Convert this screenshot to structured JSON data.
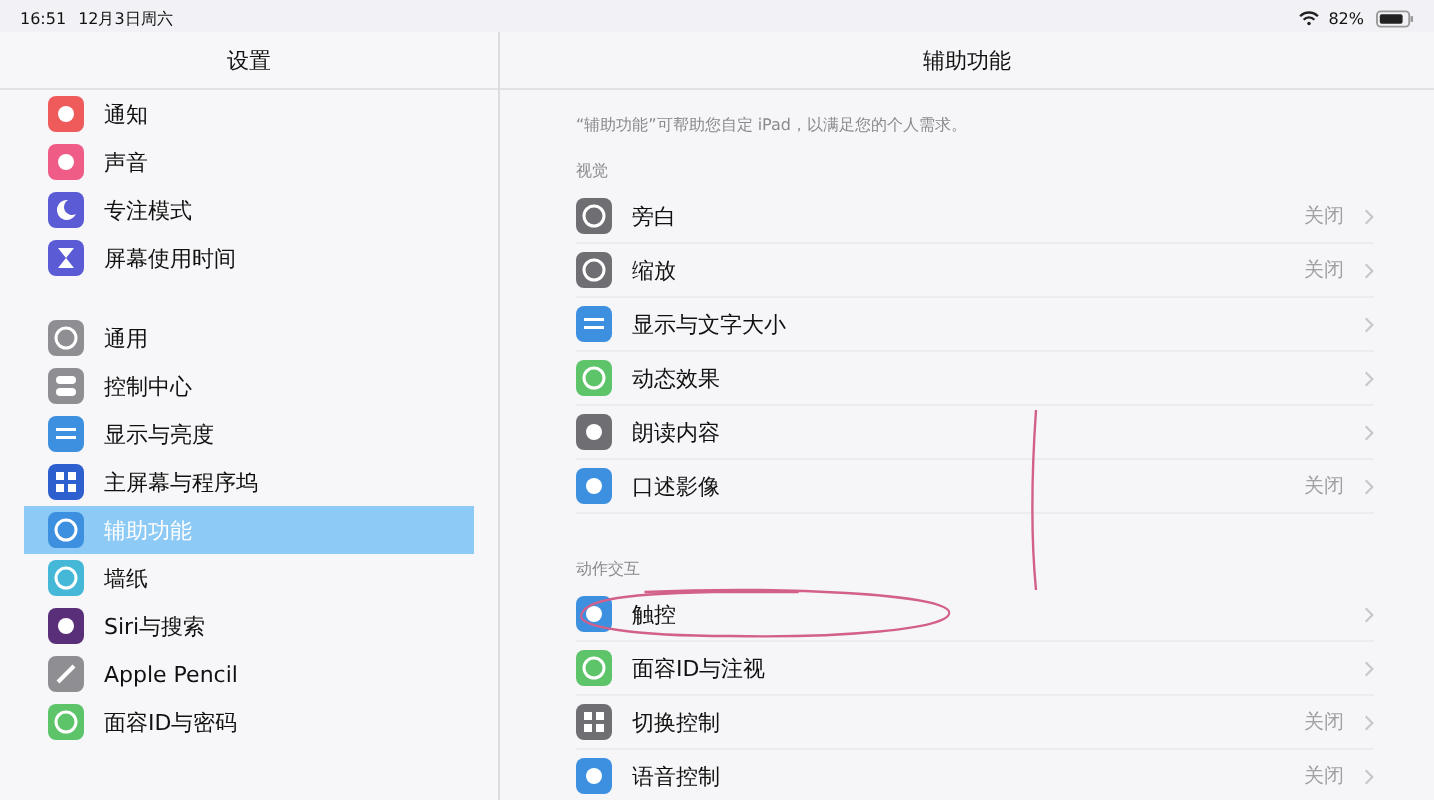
{
  "status_bar": {
    "time": "16:51",
    "date": "12月3日周六",
    "battery_text": "82%"
  },
  "sidebar": {
    "title": "设置",
    "groups": [
      [
        {
          "label": "通知",
          "color": "#ef5b5b",
          "selected": false
        },
        {
          "label": "声音",
          "color": "#ef5d87",
          "selected": false
        },
        {
          "label": "专注模式",
          "color": "#5b5bd6",
          "selected": false
        },
        {
          "label": "屏幕使用时间",
          "color": "#5b5bd6",
          "selected": false
        }
      ],
      [
        {
          "label": "通用",
          "color": "#8e8e93",
          "selected": false
        },
        {
          "label": "控制中心",
          "color": "#8e8e93",
          "selected": false
        },
        {
          "label": "显示与亮度",
          "color": "#3d8fe0",
          "selected": false
        },
        {
          "label": "主屏幕与程序坞",
          "color": "#2d5fcf",
          "selected": false
        },
        {
          "label": "辅助功能",
          "color": "#3d8fe0",
          "selected": true
        },
        {
          "label": "墙纸",
          "color": "#45b8d8",
          "selected": false
        },
        {
          "label": "Siri与搜索",
          "color": "#5a2f7a",
          "selected": false
        },
        {
          "label": "Apple Pencil",
          "color": "#8e8e93",
          "selected": false
        },
        {
          "label": "面容ID与密码",
          "color": "#5dc46a",
          "selected": false
        }
      ]
    ]
  },
  "detail": {
    "title": "辅助功能",
    "description": "“辅助功能”可帮助您自定 iPad，以满足您的个人需求。",
    "sections": [
      {
        "header": "视觉",
        "rows": [
          {
            "label": "旁白",
            "value": "关闭",
            "color": "#6e6e73"
          },
          {
            "label": "缩放",
            "value": "关闭",
            "color": "#6e6e73"
          },
          {
            "label": "显示与文字大小",
            "color": "#3d8fe0"
          },
          {
            "label": "动态效果",
            "color": "#5dc46a"
          },
          {
            "label": "朗读内容",
            "color": "#6e6e73"
          },
          {
            "label": "口述影像",
            "value": "关闭",
            "color": "#3d8fe0"
          }
        ]
      },
      {
        "header": "动作交互",
        "rows": [
          {
            "label": "触控",
            "color": "#3d8fe0"
          },
          {
            "label": "面容ID与注视",
            "color": "#5dc46a"
          },
          {
            "label": "切换控制",
            "value": "关闭",
            "color": "#6e6e73"
          },
          {
            "label": "语音控制",
            "value": "关闭",
            "color": "#3d8fe0"
          }
        ]
      }
    ]
  }
}
